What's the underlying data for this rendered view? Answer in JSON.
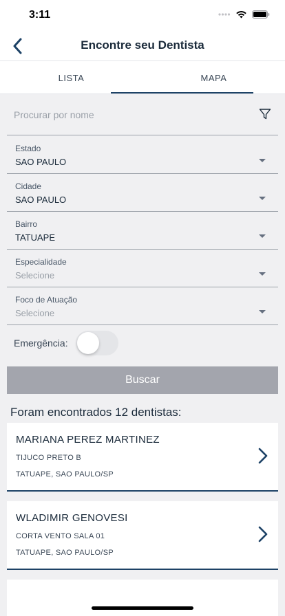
{
  "status_bar": {
    "time": "3:11"
  },
  "header": {
    "title": "Encontre seu Dentista"
  },
  "tabs": [
    {
      "label": "LISTA",
      "active": false
    },
    {
      "label": "MAPA",
      "active": true
    }
  ],
  "search": {
    "placeholder": "Procurar por nome",
    "value": ""
  },
  "filters": [
    {
      "label": "Estado",
      "value": "SAO PAULO",
      "is_placeholder": false
    },
    {
      "label": "Cidade",
      "value": "SAO PAULO",
      "is_placeholder": false
    },
    {
      "label": "Bairro",
      "value": "TATUAPE",
      "is_placeholder": false
    },
    {
      "label": "Especialidade",
      "value": "Selecione",
      "is_placeholder": true
    },
    {
      "label": "Foco de Atuação",
      "value": "Selecione",
      "is_placeholder": true
    }
  ],
  "emergency": {
    "label": "Emergência:",
    "enabled": false
  },
  "search_button": {
    "label": "Buscar"
  },
  "results": {
    "summary": "Foram encontrados 12 dentistas:",
    "items": [
      {
        "name": "MARIANA PEREZ MARTINEZ",
        "address": "TIJUCO PRETO B",
        "location": "TATUAPE, SAO PAULO/SP"
      },
      {
        "name": "WLADIMIR GENOVESI",
        "address": "CORTA VENTO SALA 01",
        "location": "TATUAPE, SAO PAULO/SP"
      }
    ]
  },
  "colors": {
    "accent": "#1d4266",
    "button_disabled": "#a3a5ad",
    "background": "#f0f0f2"
  },
  "icons": [
    "back-chevron-icon",
    "filter-icon",
    "dropdown-arrow-icon",
    "chevron-right-icon",
    "wifi-icon",
    "battery-icon",
    "signal-icon"
  ]
}
